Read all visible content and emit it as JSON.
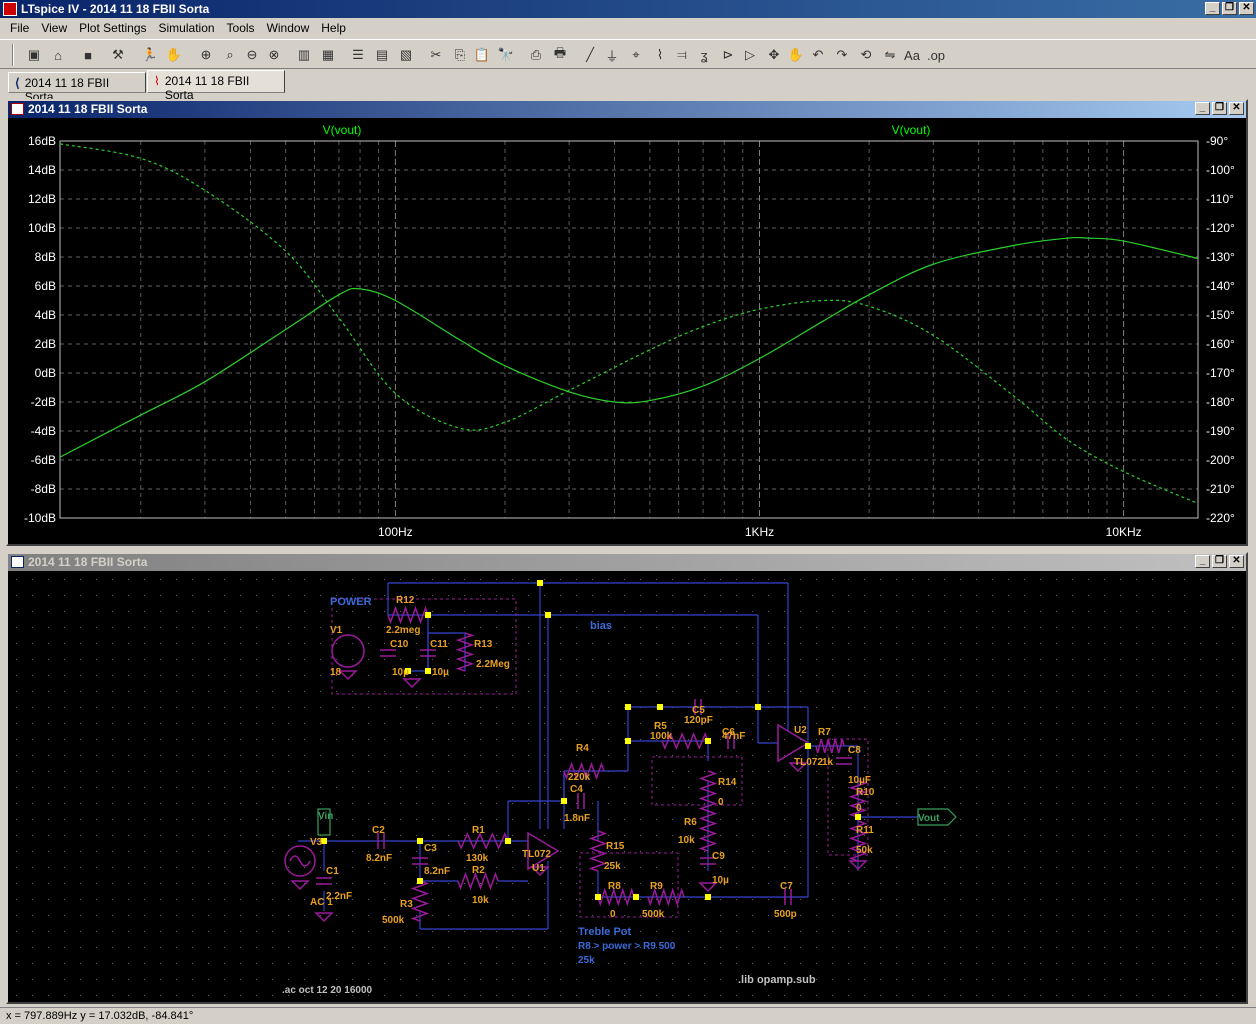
{
  "app": {
    "title": "LTspice IV - 2014 11 18 FBII Sorta"
  },
  "menu": [
    "File",
    "View",
    "Plot Settings",
    "Simulation",
    "Tools",
    "Window",
    "Help"
  ],
  "tabs": [
    {
      "label": "2014 11 18 FBII Sorta",
      "icon": "schematic-icon"
    },
    {
      "label": "2014 11 18 FBII Sorta",
      "icon": "waveform-icon"
    }
  ],
  "plot_window": {
    "title": "2014 11 18 FBII Sorta"
  },
  "schematic_window": {
    "title": "2014 11 18 FBII Sorta"
  },
  "chart_data": {
    "type": "line",
    "title": "",
    "trace_labels": [
      "V(vout)",
      "V(vout)"
    ],
    "x_scale": "log",
    "xlim_hz": [
      12,
      16000
    ],
    "x_ticks": [
      "100Hz",
      "1KHz",
      "10KHz"
    ],
    "left_axis": {
      "unit": "dB",
      "ylim": [
        -10,
        16
      ],
      "ticks": [
        "16dB",
        "14dB",
        "12dB",
        "10dB",
        "8dB",
        "6dB",
        "4dB",
        "2dB",
        "0dB",
        "-2dB",
        "-4dB",
        "-6dB",
        "-8dB",
        "-10dB"
      ]
    },
    "right_axis": {
      "unit": "deg",
      "ylim": [
        -220,
        -90
      ],
      "ticks": [
        "-90°",
        "-100°",
        "-110°",
        "-120°",
        "-130°",
        "-140°",
        "-150°",
        "-160°",
        "-170°",
        "-180°",
        "-190°",
        "-200°",
        "-210°",
        "-220°"
      ]
    },
    "grid": true,
    "series": [
      {
        "axis": "left",
        "style": "solid",
        "x": [
          12,
          20,
          30,
          50,
          70,
          80,
          100,
          150,
          200,
          300,
          400,
          500,
          700,
          1000,
          1500,
          2000,
          3000,
          5000,
          7000,
          8000,
          10000,
          16000
        ],
        "y": [
          -5.8,
          -2.9,
          -0.6,
          3.0,
          5.4,
          5.8,
          5.0,
          2.3,
          0.5,
          -1.3,
          -2.0,
          -1.9,
          -0.9,
          1.0,
          3.6,
          5.4,
          7.5,
          8.8,
          9.3,
          9.3,
          9.1,
          7.9
        ]
      },
      {
        "axis": "right",
        "style": "dashed",
        "x": [
          12,
          20,
          30,
          50,
          70,
          100,
          150,
          200,
          300,
          500,
          700,
          1000,
          1500,
          2000,
          3000,
          5000,
          7000,
          10000,
          16000
        ],
        "y": [
          -91,
          -96,
          -107,
          -128,
          -151,
          -177,
          -189,
          -187,
          -176,
          -162,
          -154,
          -148,
          -145,
          -147,
          -157,
          -178,
          -193,
          -204,
          -215
        ]
      }
    ]
  },
  "schematic": {
    "texts": [
      {
        "t": "POWER",
        "c": "#3a6ad8"
      },
      {
        "t": "R12",
        "c": "#e8a020"
      },
      {
        "t": "2.2meg",
        "c": "#e8a020"
      },
      {
        "t": "V1",
        "c": "#e8a020"
      },
      {
        "t": "18",
        "c": "#e8a020"
      },
      {
        "t": "C10",
        "c": "#e8a020"
      },
      {
        "t": "10µ",
        "c": "#e8a020"
      },
      {
        "t": "C11",
        "c": "#e8a020"
      },
      {
        "t": "10µ",
        "c": "#e8a020"
      },
      {
        "t": "R13",
        "c": "#e8a020"
      },
      {
        "t": "2.2Meg",
        "c": "#e8a020"
      },
      {
        "t": "bias",
        "c": "#3a6ad8"
      },
      {
        "t": "R5",
        "c": "#e8a020"
      },
      {
        "t": "100k",
        "c": "#e8a020"
      },
      {
        "t": "C5",
        "c": "#e8a020"
      },
      {
        "t": "120pF",
        "c": "#e8a020"
      },
      {
        "t": "C6",
        "c": "#e8a020"
      },
      {
        "t": "47nF",
        "c": "#e8a020"
      },
      {
        "t": "U2",
        "c": "#e8a020"
      },
      {
        "t": "TL072",
        "c": "#e8a020"
      },
      {
        "t": "R7",
        "c": "#e8a020"
      },
      {
        "t": "1k",
        "c": "#e8a020"
      },
      {
        "t": "C8",
        "c": "#e8a020"
      },
      {
        "t": "10µF",
        "c": "#e8a020"
      },
      {
        "t": "R10",
        "c": "#e8a020"
      },
      {
        "t": "0",
        "c": "#e8a020"
      },
      {
        "t": "R11",
        "c": "#e8a020"
      },
      {
        "t": "50k",
        "c": "#e8a020"
      },
      {
        "t": "Vout",
        "c": "#3aa060"
      },
      {
        "t": "R4",
        "c": "#e8a020"
      },
      {
        "t": "220k",
        "c": "#e8a020"
      },
      {
        "t": "C4",
        "c": "#e8a020"
      },
      {
        "t": "1.8nF",
        "c": "#e8a020"
      },
      {
        "t": "R14",
        "c": "#e8a020"
      },
      {
        "t": "0",
        "c": "#e8a020"
      },
      {
        "t": "R6",
        "c": "#e8a020"
      },
      {
        "t": "10k",
        "c": "#e8a020"
      },
      {
        "t": "C9",
        "c": "#e8a020"
      },
      {
        "t": "10µ",
        "c": "#e8a020"
      },
      {
        "t": "V3",
        "c": "#e8a020"
      },
      {
        "t": "Vin",
        "c": "#3aa060"
      },
      {
        "t": "C2",
        "c": "#e8a020"
      },
      {
        "t": "8.2nF",
        "c": "#e8a020"
      },
      {
        "t": "C3",
        "c": "#e8a020"
      },
      {
        "t": "8.2nF",
        "c": "#e8a020"
      },
      {
        "t": "R1",
        "c": "#e8a020"
      },
      {
        "t": "130k",
        "c": "#e8a020"
      },
      {
        "t": "R2",
        "c": "#e8a020"
      },
      {
        "t": "10k",
        "c": "#e8a020"
      },
      {
        "t": "TL072",
        "c": "#e8a020"
      },
      {
        "t": "U1",
        "c": "#e8a020"
      },
      {
        "t": "C1",
        "c": "#e8a020"
      },
      {
        "t": "2.2nF",
        "c": "#e8a020"
      },
      {
        "t": "AC 1",
        "c": "#e8a020"
      },
      {
        "t": "R3",
        "c": "#e8a020"
      },
      {
        "t": "500k",
        "c": "#e8a020"
      },
      {
        "t": "R15",
        "c": "#e8a020"
      },
      {
        "t": "25k",
        "c": "#e8a020"
      },
      {
        "t": "R8",
        "c": "#e8a020"
      },
      {
        "t": "0",
        "c": "#e8a020"
      },
      {
        "t": "R9",
        "c": "#e8a020"
      },
      {
        "t": "500k",
        "c": "#e8a020"
      },
      {
        "t": "C7",
        "c": "#e8a020"
      },
      {
        "t": "500p",
        "c": "#e8a020"
      },
      {
        "t": "Treble Pot",
        "c": "#3a6ad8"
      },
      {
        "t": "R8 > power > R9 500",
        "c": "#3a6ad8"
      },
      {
        "t": "25k",
        "c": "#3a6ad8"
      },
      {
        "t": ".ac oct 12 20 16000",
        "c": "#c0c0c0"
      },
      {
        "t": ".lib opamp.sub",
        "c": "#c0c0c0"
      }
    ]
  },
  "status": {
    "text": "x = 797.889Hz    y = 17.032dB, -84.841°"
  }
}
